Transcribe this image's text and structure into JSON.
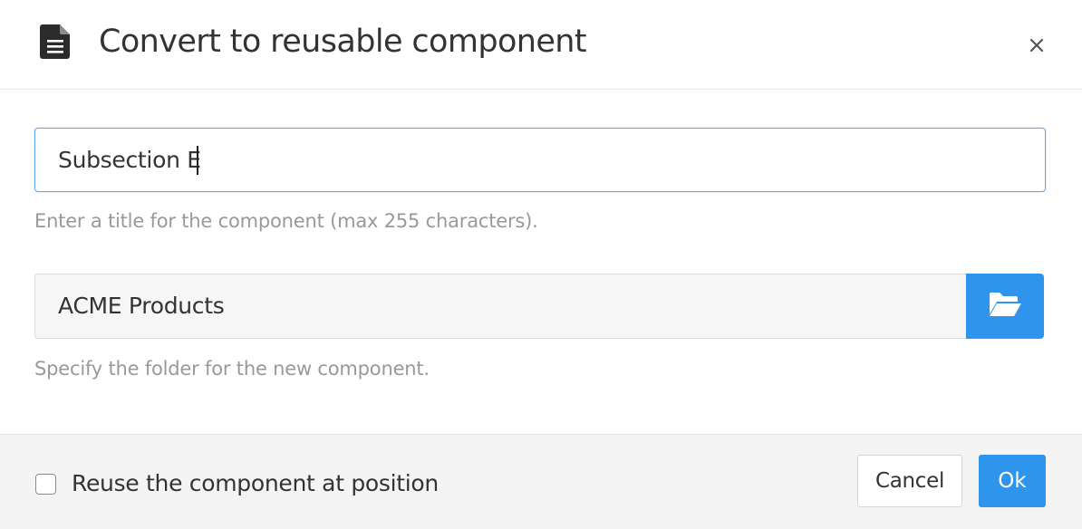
{
  "dialog": {
    "title": "Convert to reusable component",
    "title_icon": "document-icon",
    "close_icon": "close-icon"
  },
  "form": {
    "title_field": {
      "value": "Subsection E",
      "help": "Enter a title for the component (max 255 characters)."
    },
    "folder_field": {
      "value": "ACME Products",
      "button_icon": "folder-open-icon",
      "help": "Specify the folder for the new component."
    }
  },
  "footer": {
    "checkbox_label": "Reuse the component at position",
    "checkbox_checked": false,
    "cancel_label": "Cancel",
    "ok_label": "Ok"
  },
  "colors": {
    "accent": "#2f95ec",
    "input_focus_border": "#6aa9e4",
    "help_text": "#999999",
    "footer_bg": "#f4f4f4"
  }
}
